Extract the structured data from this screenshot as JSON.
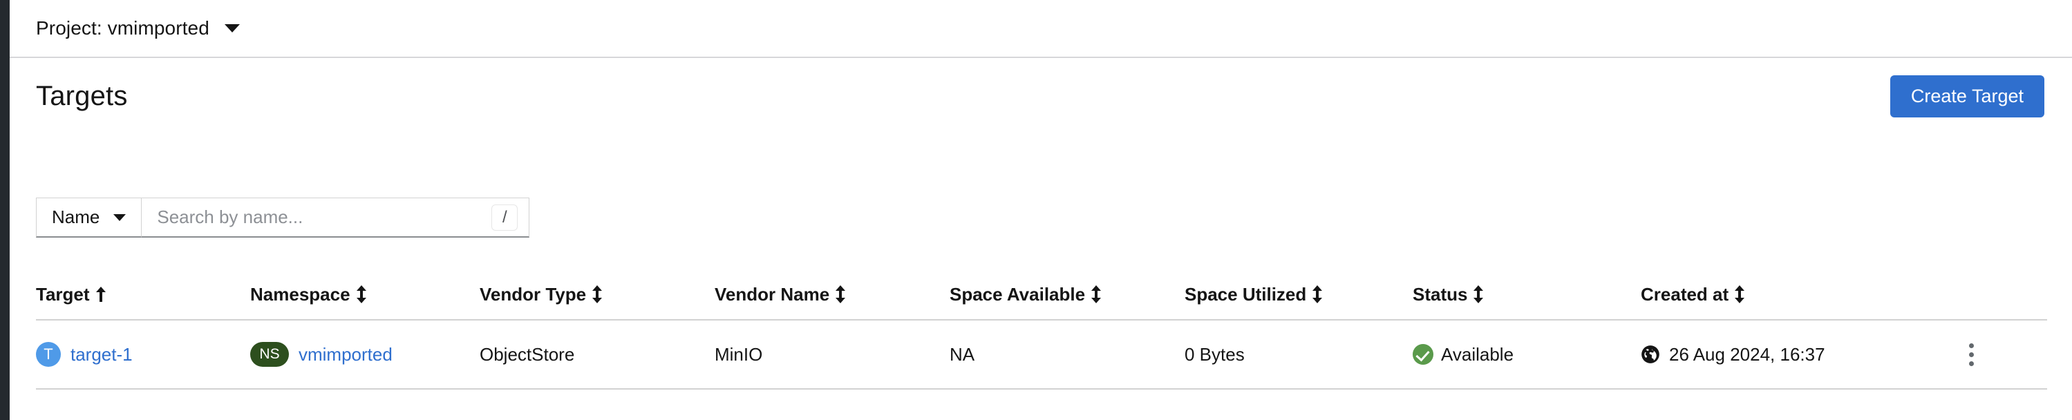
{
  "topbar": {
    "project_label": "Project: vmimported",
    "caret_icon": "chevron-down-icon"
  },
  "header": {
    "title": "Targets",
    "create_button": "Create Target"
  },
  "toolbar": {
    "filter_selected": "Name",
    "search_placeholder": "Search by name...",
    "search_value": "",
    "shortcut_key": "/"
  },
  "table": {
    "columns": [
      {
        "label": "Target",
        "sort": "asc"
      },
      {
        "label": "Namespace",
        "sort": "both"
      },
      {
        "label": "Vendor Type",
        "sort": "both"
      },
      {
        "label": "Vendor Name",
        "sort": "both"
      },
      {
        "label": "Space Available",
        "sort": "both"
      },
      {
        "label": "Space Utilized",
        "sort": "both"
      },
      {
        "label": "Status",
        "sort": "both"
      },
      {
        "label": "Created at",
        "sort": "both"
      }
    ],
    "rows": [
      {
        "target_badge": "T",
        "target": "target-1",
        "namespace_badge": "NS",
        "namespace": "vmimported",
        "vendor_type": "ObjectStore",
        "vendor_name": "MinIO",
        "space_available": "NA",
        "space_utilized": "0 Bytes",
        "status": "Available",
        "created_at": "26 Aug 2024, 16:37",
        "actions_icon": "kebab-menu-icon"
      }
    ]
  },
  "colors": {
    "accent_blue": "#2f6fce",
    "target_badge": "#4f9ae8",
    "namespace_badge": "#2d4f1e",
    "status_green": "#5a9a4b",
    "rail_dark": "#24292e"
  }
}
